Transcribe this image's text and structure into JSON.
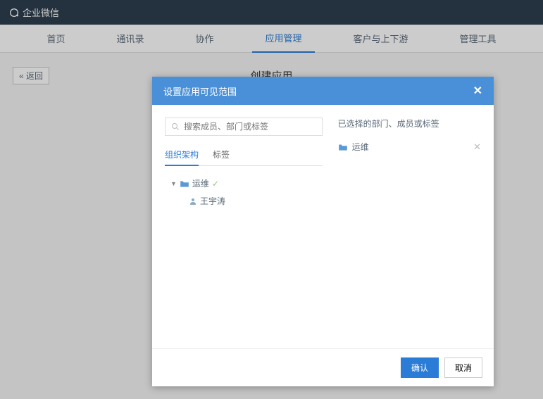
{
  "header": {
    "brand": "企业微信"
  },
  "nav": {
    "items": [
      {
        "label": "首页"
      },
      {
        "label": "通讯录"
      },
      {
        "label": "协作"
      },
      {
        "label": "应用管理",
        "active": true
      },
      {
        "label": "客户与上下游"
      },
      {
        "label": "管理工具"
      }
    ]
  },
  "page": {
    "back": "« 返回",
    "title": "创建应用"
  },
  "modal": {
    "title": "设置应用可见范围",
    "search_placeholder": "搜索成员、部门或标签",
    "tabs": {
      "org": "组织架构",
      "tags": "标签"
    },
    "tree": {
      "root": "运维",
      "member": "王宇涛"
    },
    "selected_title": "已选择的部门、成员或标签",
    "selected_items": [
      {
        "label": "运维"
      }
    ],
    "confirm": "确认",
    "cancel": "取消"
  }
}
